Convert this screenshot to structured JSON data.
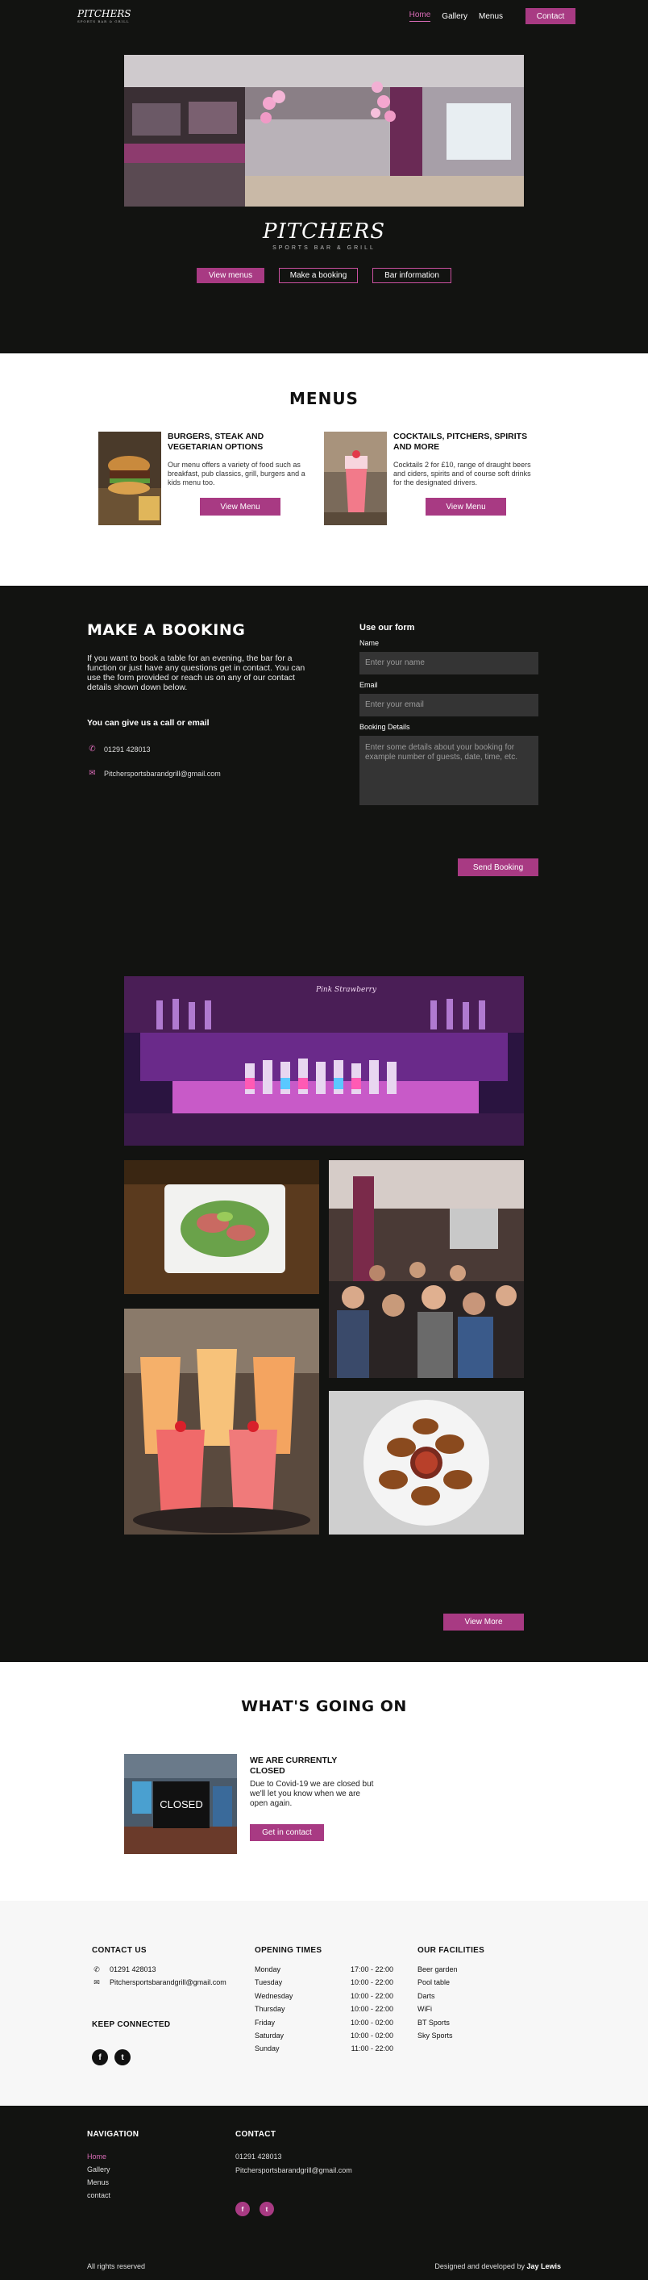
{
  "nav": {
    "logo": "PITCHERS",
    "logo_sub": "SPORTS BAR & GRILL",
    "links": [
      "Home",
      "Gallery",
      "Menus"
    ],
    "contact": "Contact"
  },
  "hero": {
    "title": "PITCHERS",
    "subtitle": "SPORTS BAR & GRILL",
    "buttons": [
      "View menus",
      "Make a booking",
      "Bar information"
    ]
  },
  "menus": {
    "heading": "MENUS",
    "cards": [
      {
        "title": "BURGERS, STEAK AND VEGETARIAN OPTIONS",
        "text": "Our menu offers a variety of food such as breakfast, pub classics, grill, burgers and a kids menu too.",
        "button": "View Menu"
      },
      {
        "title": "COCKTAILS, PITCHERS, SPIRITS AND MORE",
        "text": "Cocktails 2 for £10, range of draught beers and ciders, spirits and of course soft drinks for the designated drivers.",
        "button": "View Menu"
      }
    ]
  },
  "booking": {
    "heading": "MAKE A BOOKING",
    "intro": "If you want to book a table for an evening, the bar for a function or just have any questions get in contact. You can use the form provided or reach us on any of our contact details shown down below.",
    "call_heading": "You can give us a call or email",
    "phone": "01291 428013",
    "email": "Pitchersportsbarandgrill@gmail.com",
    "form": {
      "title": "Use our form",
      "name_label": "Name",
      "name_placeholder": "Enter your name",
      "email_label": "Email",
      "email_placeholder": "Enter your email",
      "details_label": "Booking Details",
      "details_placeholder": "Enter some details about your booking for example number of guests, date, time, etc.",
      "submit": "Send Booking"
    }
  },
  "gallery": {
    "bar_sign": "Pink Strawberry",
    "more_button": "View More"
  },
  "whatson": {
    "heading": "WHAT'S GOING ON",
    "image_caption": "CLOSED",
    "title": "WE ARE CURRENTLY CLOSED",
    "text": "Due to Covid-19 we are closed but we'll let you know when we are open again.",
    "button": "Get in contact"
  },
  "info": {
    "contact_heading": "CONTACT US",
    "phone": "01291 428013",
    "email": "Pitchersportsbarandgrill@gmail.com",
    "keep_heading": "KEEP CONNECTED",
    "social": [
      "f",
      "t"
    ],
    "hours_heading": "OPENING TIMES",
    "hours": [
      {
        "day": "Monday",
        "time": "17:00 - 22:00"
      },
      {
        "day": "Tuesday",
        "time": "10:00 - 22:00"
      },
      {
        "day": "Wednesday",
        "time": "10:00 - 22:00"
      },
      {
        "day": "Thursday",
        "time": "10:00 - 22:00"
      },
      {
        "day": "Friday",
        "time": "10:00 - 02:00"
      },
      {
        "day": "Saturday",
        "time": "10:00 - 02:00"
      },
      {
        "day": "Sunday",
        "time": "11:00 - 22:00"
      }
    ],
    "facilities_heading": "OUR FACILITIES",
    "facilities": [
      "Beer garden",
      "Pool table",
      "Darts",
      "WiFi",
      "BT Sports",
      "Sky Sports"
    ]
  },
  "footer": {
    "nav_heading": "NAVIGATION",
    "nav": [
      "Home",
      "Gallery",
      "Menus",
      "contact"
    ],
    "contact_heading": "CONTACT",
    "phone": "01291 428013",
    "email": "Pitchersportsbarandgrill@gmail.com",
    "social": [
      "f",
      "t"
    ],
    "rights": "All rights reserved",
    "credit_prefix": "Designed and developed by",
    "credit_name": "Jay Lewis"
  },
  "colors": {
    "accent": "#a83a83",
    "dark_bg": "#121311"
  }
}
